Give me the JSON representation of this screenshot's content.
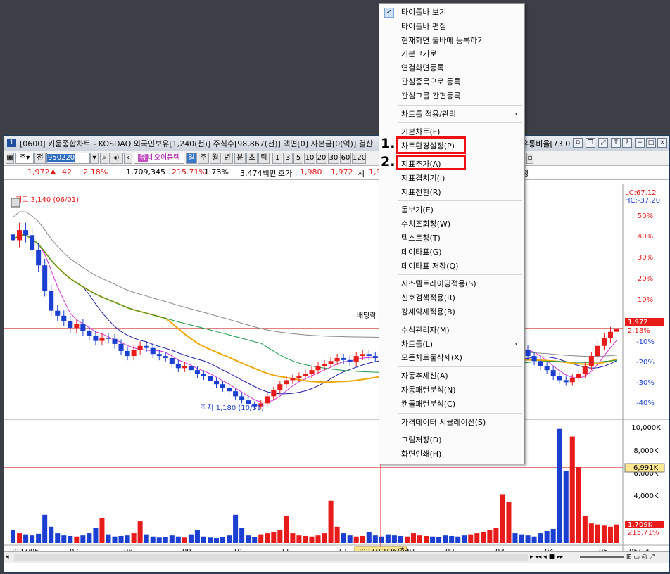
{
  "window": {
    "title": "[0600] 키움종합차트 - KOSDAQ 외국인보유[1,240(천)] 주식수[98,867(천)] 액면[0] 자본금[0(억)] 결산",
    "title_right": "유통비율[73.0",
    "icon_label": "1",
    "buttons": [
      "link-icon",
      "copy-icon",
      "expand-icon",
      "T",
      "?",
      "−",
      "□",
      "×"
    ]
  },
  "toolbar": {
    "type_label": "주",
    "all_label": "전",
    "code": "950220",
    "stock_name": "네오이뮨텍",
    "periods": [
      "일",
      "주",
      "월",
      "년",
      "분",
      "초",
      "틱"
    ],
    "active_period": "일",
    "minute_opts": [
      "1",
      "3",
      "5",
      "10",
      "20",
      "30",
      "60",
      "120"
    ],
    "right_label": "평"
  },
  "quote": {
    "price": "1,972",
    "change": "42",
    "change_pct": "+2.18%",
    "volume": "1,709,345",
    "volume_ratio": "215.71%",
    "turnover": "1.73%",
    "amount": "3,474백만",
    "ask_label": "호가",
    "ask1": "1,980",
    "bid1": "1,972",
    "open_label": "시",
    "open_partial": "1,9"
  },
  "chart_data": {
    "type": "candlestick",
    "annotations": {
      "high": "최고 3,140 (06/01)",
      "low": "최저 1,180 (10/31)",
      "dividend": "배당락",
      "crosshair_date": "2023/12/26(화)"
    },
    "price_axis": [
      "50%",
      "40%",
      "30%",
      "20%",
      "10%",
      "2.18%",
      "-10%",
      "-20%",
      "-30%",
      "-40%"
    ],
    "price_flags": {
      "lc": "LC:67.12",
      "hc": "HC:-37.20",
      "last": "1,972",
      "last_pct": "2.18%"
    },
    "volume_axis": [
      "10,000K",
      "8,000K",
      "6,000K",
      "4,000K"
    ],
    "volume_flags": {
      "mark": "6,991K",
      "last": "1,709K",
      "last_pct": "215.71%"
    },
    "x_labels": [
      "2023/05",
      "07",
      "08",
      "09",
      "10",
      "11",
      "12",
      "01",
      "02",
      "03",
      "04",
      "05",
      "05/14"
    ],
    "closes": [
      2850,
      2950,
      2900,
      2750,
      2600,
      2350,
      2150,
      2100,
      2050,
      1980,
      2020,
      1950,
      1900,
      1850,
      1880,
      1870,
      1820,
      1750,
      1700,
      1760,
      1800,
      1780,
      1720,
      1700,
      1680,
      1620,
      1580,
      1600,
      1560,
      1520,
      1500,
      1450,
      1420,
      1380,
      1350,
      1300,
      1260,
      1220,
      1200,
      1230,
      1300,
      1360,
      1420,
      1460,
      1480,
      1500,
      1520,
      1560,
      1600,
      1620,
      1650,
      1680,
      1660,
      1640,
      1700,
      1720,
      1700,
      1680,
      1650,
      1640,
      1620,
      1600,
      1630,
      1650,
      1700,
      1720,
      1680,
      1640,
      1600,
      1580,
      1560,
      1540,
      1560,
      1600,
      1660,
      1700,
      1720,
      1760,
      1800,
      1780,
      1760,
      1700,
      1650,
      1600,
      1560,
      1500,
      1460,
      1440,
      1480,
      1520,
      1600,
      1700,
      1800,
      1880,
      1940,
      1972
    ],
    "volumes": [
      1200,
      900,
      800,
      700,
      850,
      2600,
      1500,
      900,
      700,
      650,
      600,
      700,
      900,
      1400,
      2300,
      800,
      600,
      650,
      700,
      900,
      2000,
      800,
      600,
      500,
      550,
      700,
      600,
      500,
      800,
      1200,
      600,
      500,
      450,
      550,
      700,
      2600,
      1400,
      700,
      550,
      800,
      900,
      1000,
      1200,
      2500,
      900,
      700,
      650,
      600,
      700,
      900,
      3900,
      1500,
      900,
      700,
      600,
      650,
      1000,
      700,
      600,
      800,
      700,
      650,
      600,
      900,
      700,
      650,
      600,
      550,
      700,
      650,
      600,
      700,
      800,
      900,
      1000,
      1200,
      1400,
      4500,
      3800,
      900,
      800,
      700,
      600,
      900,
      1100,
      1300,
      10500,
      6600,
      9800,
      6991,
      2500,
      1800,
      1709,
      1600,
      1500,
      1700
    ]
  },
  "menu": {
    "items": [
      {
        "label": "타이틀바 보기",
        "checked": true
      },
      {
        "label": "타이틀바 편집"
      },
      {
        "label": "현재화면 툴바에 등록하기"
      },
      {
        "label": "기본크기로"
      },
      {
        "label": "연결화면등록"
      },
      {
        "label": "관심종목으로 등록"
      },
      {
        "label": "관심그룹 간편등록"
      },
      {
        "sep": true
      },
      {
        "label": "차트틀 적용/관리",
        "sub": true
      },
      {
        "sep": true
      },
      {
        "label": "기본차트(F)"
      },
      {
        "label": "차트환경설정(P)"
      },
      {
        "sep": true
      },
      {
        "label": "지표추가(A)"
      },
      {
        "label": "지표겹치기(I)"
      },
      {
        "label": "지표전환(R)"
      },
      {
        "sep": true
      },
      {
        "label": "돋보기(E)"
      },
      {
        "label": "수치조회창(W)"
      },
      {
        "label": "텍스트창(T)"
      },
      {
        "label": "데이타표(G)"
      },
      {
        "label": "데이타표 저장(Q)"
      },
      {
        "sep": true
      },
      {
        "label": "시스템트레이딩적용(S)"
      },
      {
        "label": "신호검색적용(R)"
      },
      {
        "label": "강세약세적용(B)"
      },
      {
        "sep": true
      },
      {
        "label": "수식관리자(M)"
      },
      {
        "label": "차트툴(L)",
        "sub": true
      },
      {
        "label": "모든차트툴삭제(X)"
      },
      {
        "sep": true
      },
      {
        "label": "자동추세선(A)"
      },
      {
        "label": "자동패턴분석(N)"
      },
      {
        "label": "캔들패턴분석(C)"
      },
      {
        "sep": true
      },
      {
        "label": "가격데이터 시뮬레이션(S)"
      },
      {
        "sep": true
      },
      {
        "label": "그림저장(D)"
      },
      {
        "label": "화면인쇄(H)"
      }
    ],
    "marker1": "1.",
    "marker2": "2."
  },
  "colors": {
    "up": "#e81b1b",
    "down": "#1a3fd1",
    "ma5": "#d62dd6",
    "ma20": "#1f1fa8",
    "ma60": "#f0a800",
    "ma120": "#1b9a4a",
    "ma240": "#888888",
    "highlight": "#e11111"
  }
}
